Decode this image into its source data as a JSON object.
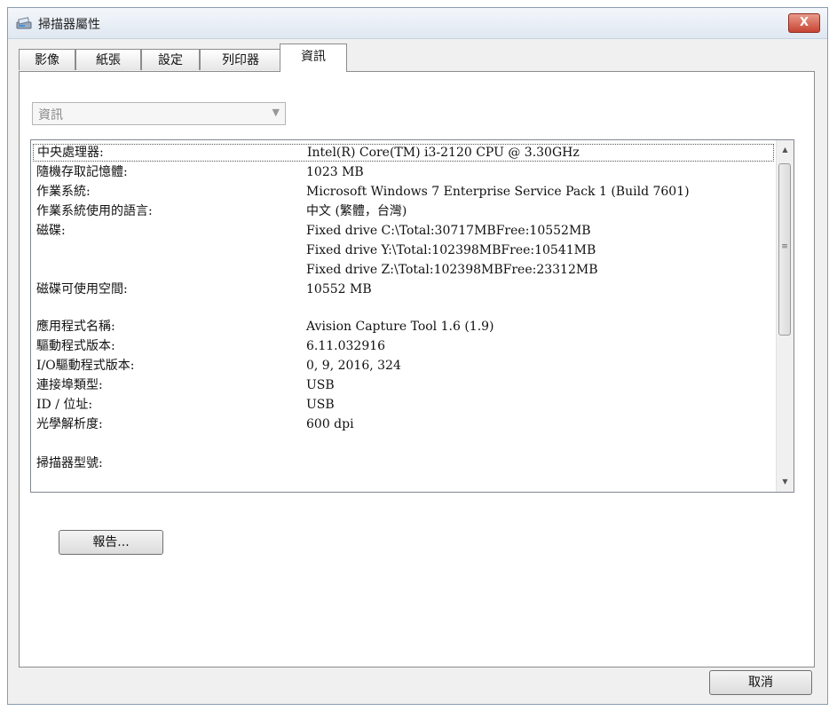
{
  "window": {
    "title": "掃描器屬性",
    "close_label": "X"
  },
  "tabs": [
    {
      "label": "影像"
    },
    {
      "label": "紙張"
    },
    {
      "label": "設定"
    },
    {
      "label": "列印器"
    },
    {
      "label": "資訊"
    }
  ],
  "active_tab": "資訊",
  "combo": {
    "value": "資訊"
  },
  "info": {
    "rows": [
      {
        "label": "中央處理器:",
        "value": "Intel(R) Core(TM) i3-2120 CPU @ 3.30GHz"
      },
      {
        "label": "隨機存取記憶體:",
        "value": "1023 MB"
      },
      {
        "label": "作業系統:",
        "value": "Microsoft Windows 7 Enterprise Service Pack 1 (Build 7601)"
      },
      {
        "label": "作業系統使用的語言:",
        "value": "中文 (繁體，台灣)"
      },
      {
        "label": "磁碟:",
        "value": "Fixed drive C:\\Total:30717MBFree:10552MB"
      },
      {
        "label": "",
        "value": "Fixed drive Y:\\Total:102398MBFree:10541MB"
      },
      {
        "label": "",
        "value": "Fixed drive Z:\\Total:102398MBFree:23312MB"
      },
      {
        "label": "磁碟可使用空間:",
        "value": "10552 MB"
      },
      {
        "label": "應用程式名稱:",
        "value": "Avision Capture Tool 1.6 (1.9)"
      },
      {
        "label": "驅動程式版本:",
        "value": "6.11.032916"
      },
      {
        "label": "I/O驅動程式版本:",
        "value": "0, 9, 2016, 324"
      },
      {
        "label": "連接埠類型:",
        "value": "USB"
      },
      {
        "label": "ID / 位址:",
        "value": "USB"
      },
      {
        "label": "光學解析度:",
        "value": "600 dpi"
      },
      {
        "label": "掃描器型號:",
        "value": ""
      }
    ]
  },
  "buttons": {
    "report": "報告...",
    "cancel": "取消"
  },
  "icons": {
    "app": "scanner-icon",
    "scroll_up": "scroll-up-icon",
    "scroll_down": "scroll-down-icon",
    "dropdown": "chevron-down-icon"
  }
}
